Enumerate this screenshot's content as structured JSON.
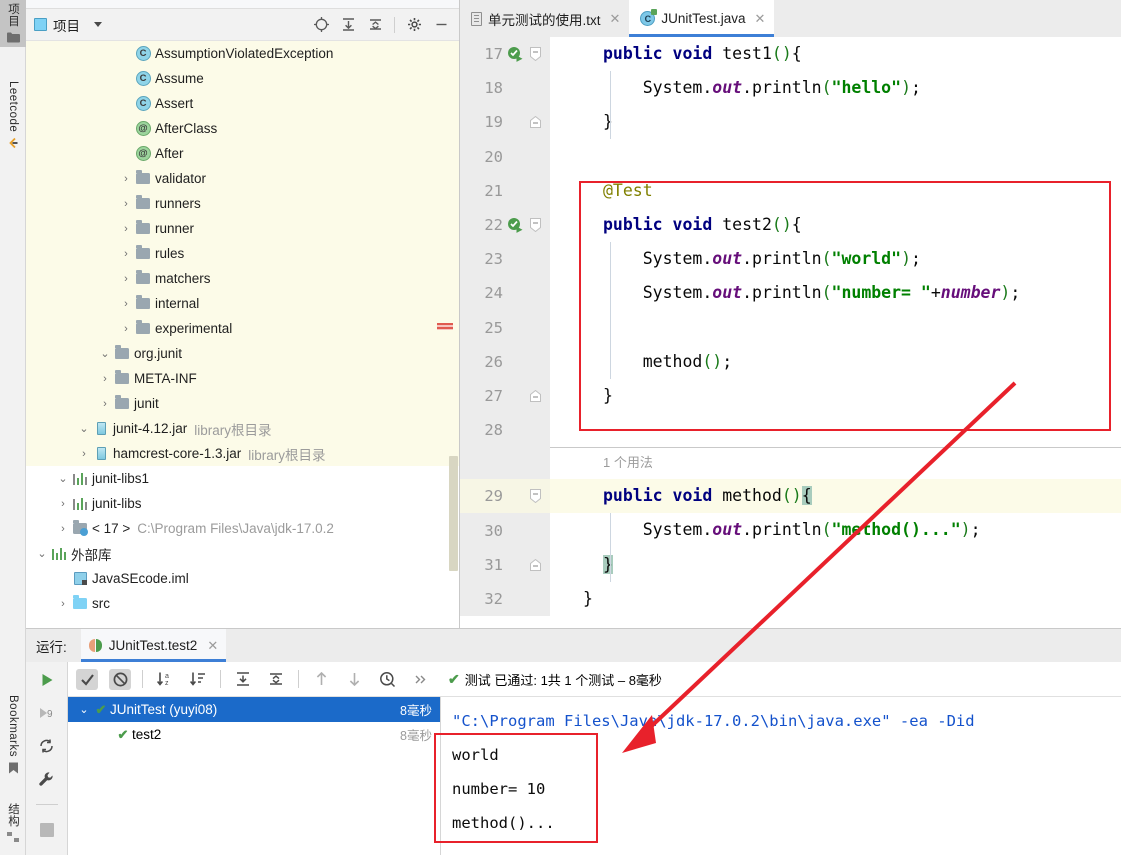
{
  "left_strip": {
    "tabs": [
      {
        "label": "项目",
        "icon": "folder-icon",
        "selected": true
      },
      {
        "label": "Leetcode",
        "icon": "leetcode-icon",
        "selected": false
      },
      {
        "label": "Bookmarks",
        "icon": "bookmark-icon",
        "selected": false
      },
      {
        "label": "结构",
        "icon": "structure-icon",
        "selected": false
      }
    ]
  },
  "project_panel": {
    "title": "项目",
    "tools": [
      {
        "name": "select-opened-file-icon",
        "glyph": "⊕"
      },
      {
        "name": "expand-all-icon",
        "glyph": "⇟"
      },
      {
        "name": "collapse-all-icon",
        "glyph": "⇞"
      },
      {
        "name": "settings-gear-icon",
        "glyph": "⚙"
      },
      {
        "name": "hide-panel-icon",
        "glyph": "—"
      }
    ],
    "tree": [
      {
        "label": "src",
        "indent": 1,
        "arrow": "collapsed",
        "icon": "folder-blue",
        "dim": "",
        "jarbg": false
      },
      {
        "label": "JavaSEcode.iml",
        "indent": 1,
        "arrow": "none",
        "icon": "module",
        "dim": "",
        "jarbg": false
      },
      {
        "label": "外部库",
        "indent": 0,
        "arrow": "expanded",
        "icon": "library",
        "dim": "",
        "jarbg": false
      },
      {
        "label": "< 17 >",
        "indent": 1,
        "arrow": "collapsed",
        "icon": "jdk",
        "dim": "C:\\Program Files\\Java\\jdk-17.0.2",
        "jarbg": false
      },
      {
        "label": "junit-libs",
        "indent": 1,
        "arrow": "collapsed",
        "icon": "library-node",
        "dim": "",
        "jarbg": false
      },
      {
        "label": "junit-libs1",
        "indent": 1,
        "arrow": "expanded",
        "icon": "library-node",
        "dim": "",
        "jarbg": false
      },
      {
        "label": "hamcrest-core-1.3.jar",
        "indent": 2,
        "arrow": "collapsed",
        "icon": "jar",
        "dim": "library根目录",
        "jarbg": true
      },
      {
        "label": "junit-4.12.jar",
        "indent": 2,
        "arrow": "expanded",
        "icon": "jar",
        "dim": "library根目录",
        "jarbg": true
      },
      {
        "label": "junit",
        "indent": 3,
        "arrow": "collapsed",
        "icon": "folder-gray",
        "dim": "",
        "jarbg": true
      },
      {
        "label": "META-INF",
        "indent": 3,
        "arrow": "collapsed",
        "icon": "folder-gray",
        "dim": "",
        "jarbg": true
      },
      {
        "label": "org.junit",
        "indent": 3,
        "arrow": "expanded",
        "icon": "folder-gray",
        "dim": "",
        "jarbg": true
      },
      {
        "label": "experimental",
        "indent": 4,
        "arrow": "collapsed",
        "icon": "folder-gray",
        "dim": "",
        "jarbg": true
      },
      {
        "label": "internal",
        "indent": 4,
        "arrow": "collapsed",
        "icon": "folder-gray",
        "dim": "",
        "jarbg": true
      },
      {
        "label": "matchers",
        "indent": 4,
        "arrow": "collapsed",
        "icon": "folder-gray",
        "dim": "",
        "jarbg": true
      },
      {
        "label": "rules",
        "indent": 4,
        "arrow": "collapsed",
        "icon": "folder-gray",
        "dim": "",
        "jarbg": true
      },
      {
        "label": "runner",
        "indent": 4,
        "arrow": "collapsed",
        "icon": "folder-gray",
        "dim": "",
        "jarbg": true
      },
      {
        "label": "runners",
        "indent": 4,
        "arrow": "collapsed",
        "icon": "folder-gray",
        "dim": "",
        "jarbg": true
      },
      {
        "label": "validator",
        "indent": 4,
        "arrow": "collapsed",
        "icon": "folder-gray",
        "dim": "",
        "jarbg": true
      },
      {
        "label": "After",
        "indent": 4,
        "arrow": "none",
        "icon": "annotation",
        "dim": "",
        "jarbg": true
      },
      {
        "label": "AfterClass",
        "indent": 4,
        "arrow": "none",
        "icon": "annotation",
        "dim": "",
        "jarbg": true
      },
      {
        "label": "Assert",
        "indent": 4,
        "arrow": "none",
        "icon": "class",
        "dim": "",
        "jarbg": true
      },
      {
        "label": "Assume",
        "indent": 4,
        "arrow": "none",
        "icon": "class",
        "dim": "",
        "jarbg": true
      },
      {
        "label": "AssumptionViolatedException",
        "indent": 4,
        "arrow": "none",
        "icon": "class",
        "dim": "",
        "jarbg": true
      }
    ]
  },
  "editor": {
    "tabs": [
      {
        "label": "单元测试的使用.txt",
        "icon": "text-file-icon",
        "active": false,
        "close": "✕"
      },
      {
        "label": "JUnitTest.java",
        "icon": "java-class-icon",
        "active": true,
        "close": "✕"
      }
    ],
    "usage_hint": "1 个用法",
    "lines": [
      {
        "num": "17",
        "run_icon": true,
        "fold": "minus",
        "html": "<span class=\"kw\">public</span> <span class=\"kw\">void</span> test1<span class=\"paren\">()</span>{"
      },
      {
        "num": "18",
        "run_icon": false,
        "fold": "",
        "html": "    System.<span class=\"fld\">out</span>.println<span class=\"paren\">(</span><span class=\"str\">\"hello\"</span><span class=\"paren\">)</span>;"
      },
      {
        "num": "19",
        "run_icon": false,
        "fold": "end",
        "html": "}"
      },
      {
        "num": "20",
        "run_icon": false,
        "fold": "",
        "html": ""
      },
      {
        "num": "21",
        "run_icon": false,
        "fold": "",
        "html": "<span class=\"ann\">@Test</span>"
      },
      {
        "num": "22",
        "run_icon": true,
        "fold": "minus",
        "html": "<span class=\"kw\">public</span> <span class=\"kw\">void</span> test2<span class=\"paren\">()</span>{"
      },
      {
        "num": "23",
        "run_icon": false,
        "fold": "",
        "html": "    System.<span class=\"fld\">out</span>.println<span class=\"paren\">(</span><span class=\"str\">\"world\"</span><span class=\"paren\">)</span>;"
      },
      {
        "num": "24",
        "run_icon": false,
        "fold": "",
        "html": "    System.<span class=\"fld\">out</span>.println<span class=\"paren\">(</span><span class=\"str\">\"number= \"</span>+<span class=\"fld\">number</span><span class=\"paren\">)</span>;"
      },
      {
        "num": "25",
        "run_icon": false,
        "fold": "",
        "html": ""
      },
      {
        "num": "26",
        "run_icon": false,
        "fold": "",
        "html": "    method<span class=\"paren\">()</span>;"
      },
      {
        "num": "27",
        "run_icon": false,
        "fold": "end",
        "html": "}"
      },
      {
        "num": "28",
        "run_icon": false,
        "fold": "",
        "html": ""
      },
      {
        "num": "29",
        "run_icon": false,
        "fold": "minus",
        "hl": true,
        "html": "<span class=\"kw\">public</span> <span class=\"kw\">void</span> method<span class=\"paren\">()</span><span class=\"brace-hl\">{</span>"
      },
      {
        "num": "30",
        "run_icon": false,
        "fold": "",
        "html": "    System.<span class=\"fld\">out</span>.println<span class=\"paren\">(</span><span class=\"str\">\"method()...\"</span><span class=\"paren\">)</span>;"
      },
      {
        "num": "31",
        "run_icon": false,
        "fold": "end",
        "html": "<span class=\"brace-hl\">}</span>"
      },
      {
        "num": "32",
        "run_icon": false,
        "fold": "",
        "html": "}",
        "outdent": true
      }
    ]
  },
  "run_panel": {
    "label": "运行:",
    "tab_label": "JUnitTest.test2",
    "tab_close": "✕",
    "gutter_icons": [
      {
        "name": "rerun-icon",
        "glyph": "▶"
      },
      {
        "name": "rerun-failed-tests-icon",
        "glyph": "9"
      },
      {
        "name": "toggle-auto-test-icon",
        "glyph": "⟳"
      },
      {
        "name": "settings-wrench-icon",
        "glyph": "🔧"
      },
      {
        "name": "stop-icon",
        "glyph": "■"
      }
    ],
    "toolbar_icons": [
      {
        "name": "show-passed-icon",
        "glyph": "✔",
        "pressed": true
      },
      {
        "name": "hide-ignored-icon",
        "glyph": "⊘",
        "pressed": true
      },
      {
        "name": "sort-alphabetically-icon",
        "glyph": "↓ᴀᶻ",
        "pressed": false
      },
      {
        "name": "sort-by-duration-icon",
        "glyph": "↓☰",
        "pressed": false
      },
      {
        "name": "expand-all-icon",
        "glyph": "⇟",
        "pressed": false
      },
      {
        "name": "collapse-all-icon",
        "glyph": "⇞",
        "pressed": false
      },
      {
        "name": "prev-failed-test-icon",
        "glyph": "↑",
        "pressed": false
      },
      {
        "name": "next-failed-test-icon",
        "glyph": "↓",
        "pressed": false
      },
      {
        "name": "test-history-icon",
        "glyph": "◷",
        "pressed": false
      },
      {
        "name": "more-options-icon",
        "glyph": "»",
        "pressed": false
      }
    ],
    "status_text": "测试 已通过: 1共 1 个测试 – 8毫秒",
    "test_tree": [
      {
        "label": "JUnitTest (yuyi08)",
        "duration": "8毫秒",
        "selected": true,
        "arrow": "⌄",
        "depth": 0
      },
      {
        "label": "test2",
        "duration": "8毫秒",
        "selected": false,
        "arrow": "",
        "depth": 1
      }
    ],
    "console": [
      {
        "text": "\"C:\\Program Files\\Java\\jdk-17.0.2\\bin\\java.exe\" -ea -Did",
        "blue": true
      },
      {
        "text": "world",
        "blue": false
      },
      {
        "text": "number= 10",
        "blue": false
      },
      {
        "text": "method()...",
        "blue": false
      }
    ]
  },
  "annotations": {
    "accent_red": "#e8212b",
    "selection_blue": "#1b6ac9"
  }
}
